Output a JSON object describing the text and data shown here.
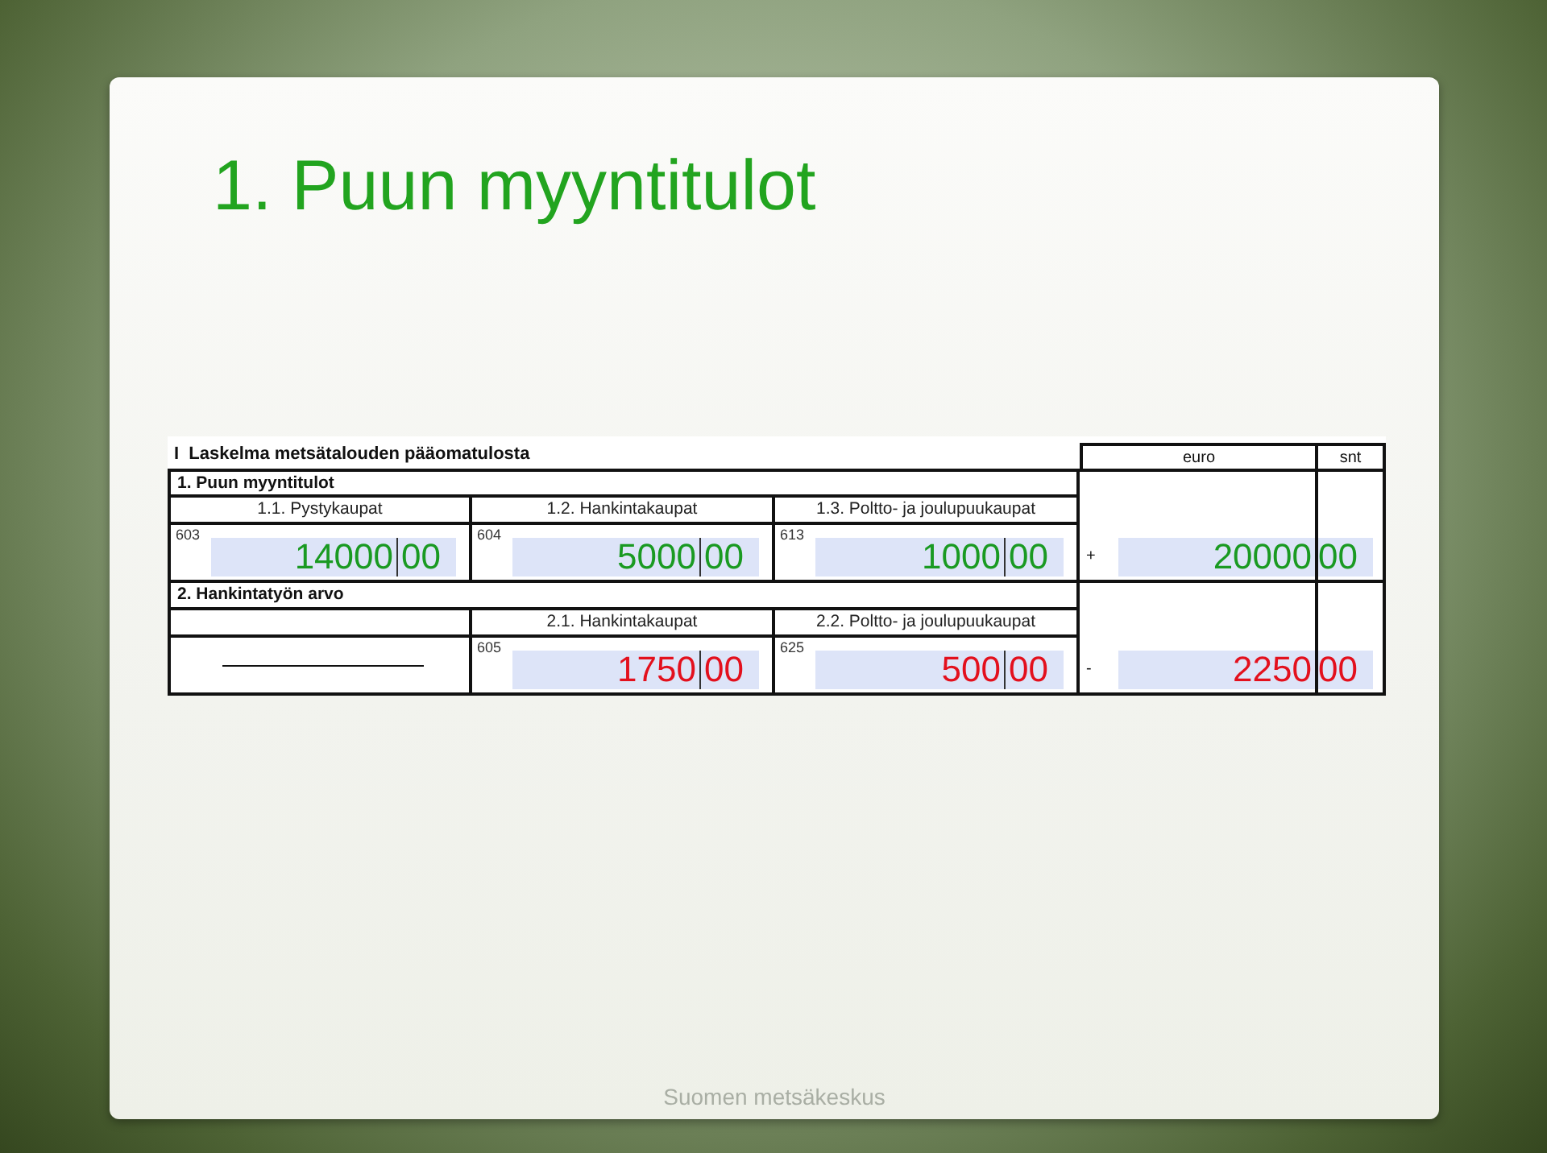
{
  "title": "1. Puun myyntitulot",
  "form": {
    "heading": "I  Laskelma metsätalouden pääomatulosta",
    "columns": [
      "euro",
      "snt"
    ],
    "sections": [
      {
        "label": "1. Puun myyntitulot",
        "kind": "income",
        "operator": "+",
        "parts": [
          {
            "kind": "amount",
            "label": "1.1. Pystykaupat",
            "code": "603",
            "euro": "14000",
            "snt": "00"
          },
          {
            "kind": "amount",
            "label": "1.2. Hankintakaupat",
            "code": "604",
            "euro": "5000",
            "snt": "00"
          },
          {
            "kind": "amount",
            "label": "1.3. Poltto- ja joulupuukaupat",
            "code": "613",
            "euro": "1000",
            "snt": "00"
          }
        ],
        "total": {
          "euro": "20000",
          "snt": "00"
        }
      },
      {
        "label": "2. Hankintatyön arvo",
        "kind": "deduction",
        "operator": "-",
        "parts": [
          {
            "kind": "blank"
          },
          {
            "kind": "amount",
            "label": "2.1. Hankintakaupat",
            "code": "605",
            "euro": "1750",
            "snt": "00"
          },
          {
            "kind": "amount",
            "label": "2.2. Poltto- ja joulupuukaupat",
            "code": "625",
            "euro": "500",
            "snt": "00"
          }
        ],
        "total": {
          "euro": "2250",
          "snt": "00"
        }
      }
    ]
  },
  "footer": "Suomen metsäkeskus"
}
